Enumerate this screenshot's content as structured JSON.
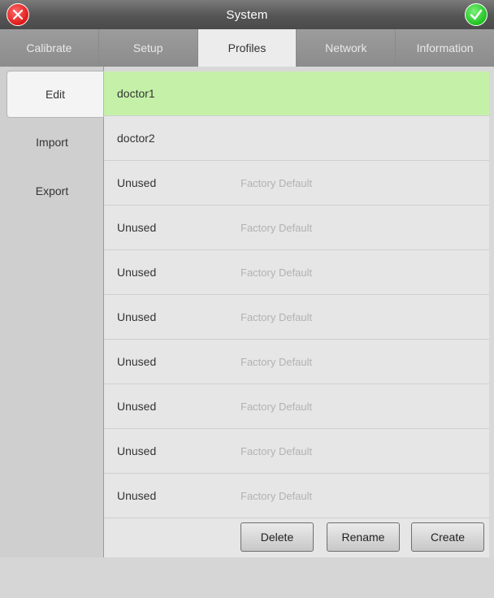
{
  "window": {
    "title": "System",
    "close_icon": "close-circle-icon",
    "ok_icon": "check-circle-icon"
  },
  "tabs": [
    {
      "label": "Calibrate",
      "active": false
    },
    {
      "label": "Setup",
      "active": false
    },
    {
      "label": "Profiles",
      "active": true
    },
    {
      "label": "Network",
      "active": false
    },
    {
      "label": "Information",
      "active": false
    }
  ],
  "sidebar": {
    "items": [
      {
        "label": "Edit",
        "active": true
      },
      {
        "label": "Import",
        "active": false
      },
      {
        "label": "Export",
        "active": false
      }
    ]
  },
  "profiles": [
    {
      "name": "doctor1",
      "note": "",
      "selected": true
    },
    {
      "name": "doctor2",
      "note": "",
      "selected": false
    },
    {
      "name": "Unused",
      "note": "Factory Default",
      "selected": false
    },
    {
      "name": "Unused",
      "note": "Factory Default",
      "selected": false
    },
    {
      "name": "Unused",
      "note": "Factory Default",
      "selected": false
    },
    {
      "name": "Unused",
      "note": "Factory Default",
      "selected": false
    },
    {
      "name": "Unused",
      "note": "Factory Default",
      "selected": false
    },
    {
      "name": "Unused",
      "note": "Factory Default",
      "selected": false
    },
    {
      "name": "Unused",
      "note": "Factory Default",
      "selected": false
    },
    {
      "name": "Unused",
      "note": "Factory Default",
      "selected": false
    }
  ],
  "actions": {
    "delete": "Delete",
    "rename": "Rename",
    "create": "Create"
  },
  "colors": {
    "selected_row": "#c4f1a7",
    "close": "#e01818",
    "ok": "#1fc21f"
  }
}
